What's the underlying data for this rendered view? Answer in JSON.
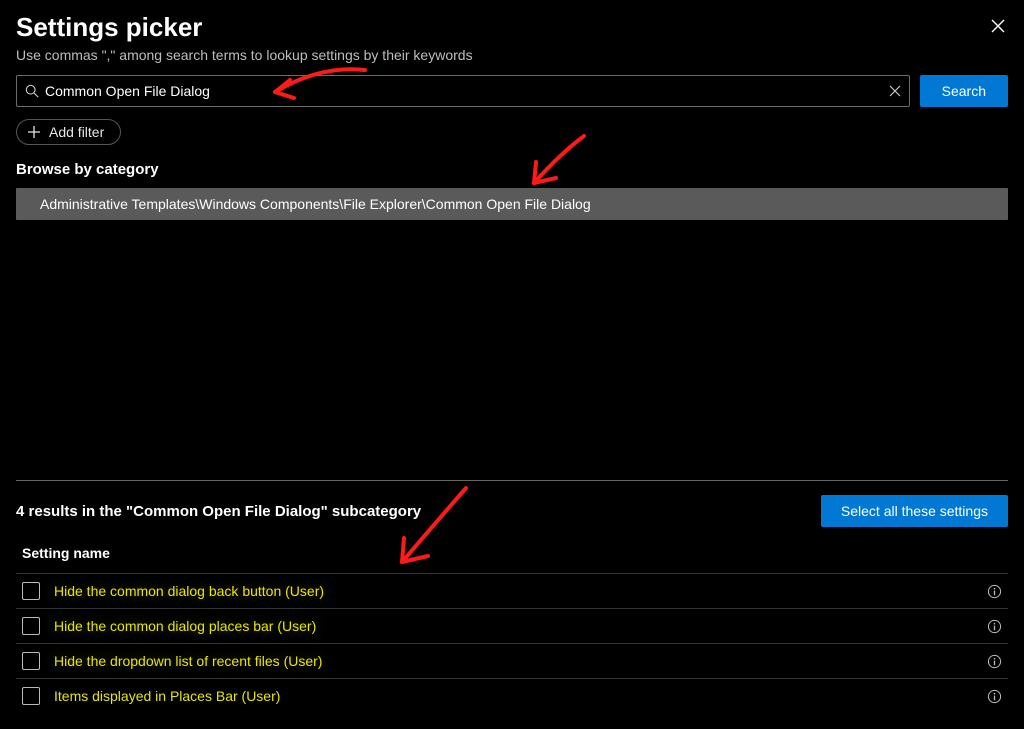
{
  "header": {
    "title": "Settings picker",
    "subtitle": "Use commas \",\" among search terms to lookup settings by their keywords"
  },
  "search": {
    "value": "Common Open File Dialog",
    "button_label": "Search"
  },
  "add_filter_label": "Add filter",
  "browse_label": "Browse by category",
  "category_path": "Administrative Templates\\Windows Components\\File Explorer\\Common Open File Dialog",
  "results": {
    "count_text": "4 results in the \"Common Open File Dialog\" subcategory",
    "select_all_label": "Select all these settings",
    "column_header": "Setting name",
    "items": [
      {
        "label": "Hide the common dialog back button (User)"
      },
      {
        "label": "Hide the common dialog places bar (User)"
      },
      {
        "label": "Hide the dropdown list of recent files (User)"
      },
      {
        "label": "Items displayed in Places Bar (User)"
      }
    ]
  }
}
